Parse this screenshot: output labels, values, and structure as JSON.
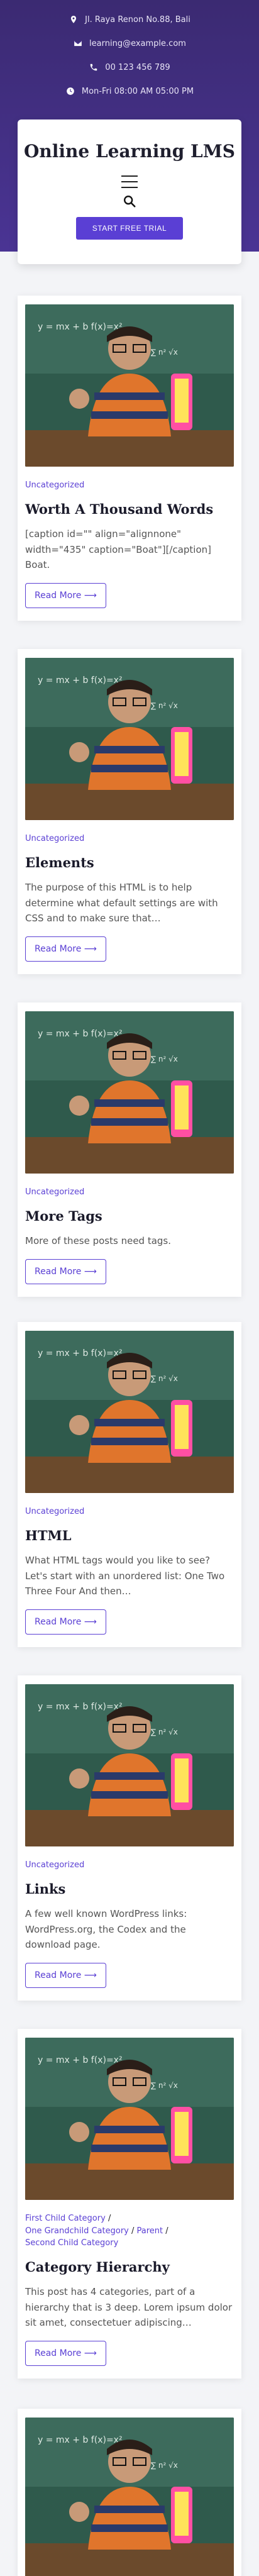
{
  "topbar": {
    "address": "Jl. Raya Renon No.88, Bali",
    "email": "learning@example.com",
    "phone": "00 123 456 789",
    "hours": "Mon-Fri 08:00 AM 05:00 PM"
  },
  "header": {
    "site_title": "Online Learning LMS",
    "cta_label": "START FREE TRIAL"
  },
  "posts": [
    {
      "category": "Uncategorized",
      "title": "Worth A Thousand Words",
      "excerpt": "[caption id=\"\" align=\"alignnone\" width=\"435\" caption=\"Boat\"][/caption] Boat.",
      "read_more": "Read More ⟶"
    },
    {
      "category": "Uncategorized",
      "title": "Elements",
      "excerpt": "The purpose of this HTML is to help determine what default settings are with CSS and to make sure that…",
      "read_more": "Read More ⟶"
    },
    {
      "category": "Uncategorized",
      "title": "More Tags",
      "excerpt": "More of these posts need tags.",
      "read_more": "Read More ⟶"
    },
    {
      "category": "Uncategorized",
      "title": "HTML",
      "excerpt": "What HTML tags would you like to see? Let's start with an unordered list: One Two Three Four And then…",
      "read_more": "Read More ⟶"
    },
    {
      "category": "Uncategorized",
      "title": "Links",
      "excerpt": "A few well known WordPress links: WordPress.org, the Codex and the download page.",
      "read_more": "Read More ⟶"
    },
    {
      "categories": [
        "First Child Category",
        "One Grandchild Category",
        "Parent",
        "Second Child Category"
      ],
      "title": "Category Hierarchy",
      "excerpt": "This post has 4 categories, part of a hierarchy that is 3 deep. Lorem ipsum dolor sit amet, consectetuer adipiscing…",
      "read_more": "Read More ⟶"
    }
  ]
}
